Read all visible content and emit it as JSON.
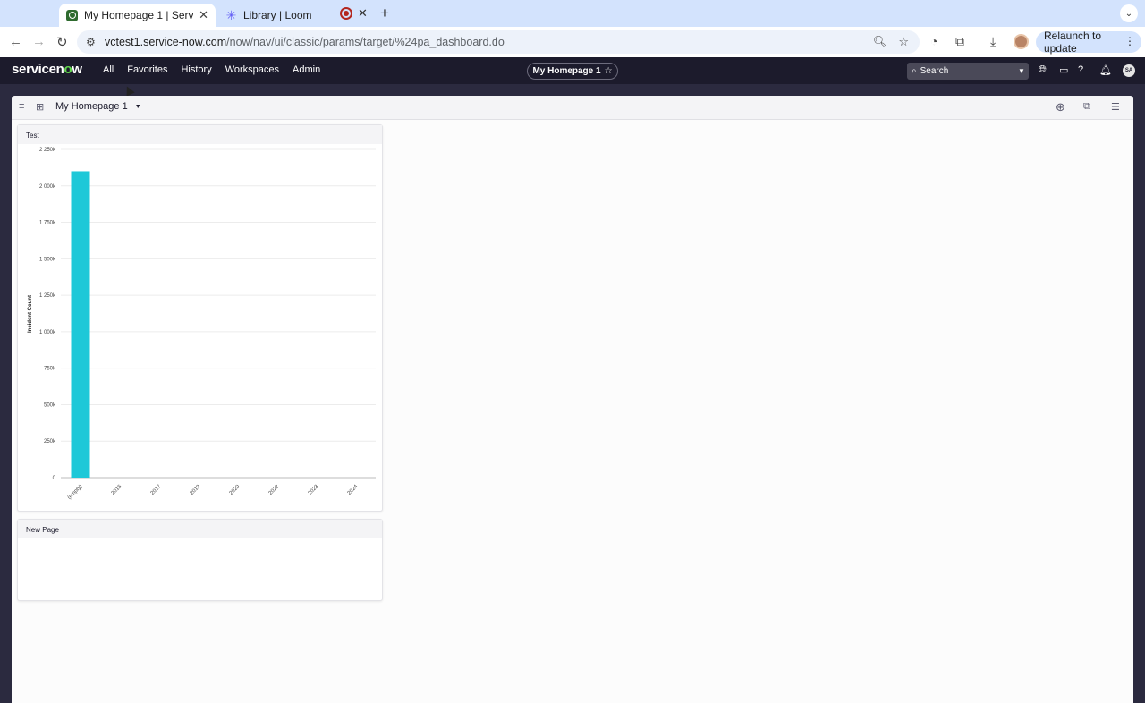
{
  "browser": {
    "tabs": [
      {
        "title": "My Homepage 1 | ServiceNow",
        "icon": "servicenow-favicon-icon",
        "active": true
      },
      {
        "title": "Library | Loom",
        "icon": "loom-favicon-icon",
        "active": false
      }
    ],
    "url_host": "vctest1.service-now.com",
    "url_path": "/now/nav/ui/classic/params/target/%24pa_dashboard.do",
    "relaunch_label": "Relaunch to update"
  },
  "servicenow": {
    "logo_text_before": "servicen",
    "logo_text_o": "o",
    "logo_text_after": "w",
    "nav": [
      "All",
      "Favorites",
      "History",
      "Workspaces",
      "Admin"
    ],
    "context_title": "My Homepage 1",
    "search_placeholder": "Search",
    "user_initials": "SA",
    "colors": {
      "header_bg": "#1c1b2c",
      "logo_accent": "#62d84e"
    }
  },
  "dashboard": {
    "title": "My Homepage 1",
    "widgets": [
      {
        "title": "Test"
      },
      {
        "title": "New Page"
      }
    ]
  },
  "chart_data": {
    "type": "bar",
    "title": "Test",
    "ylabel": "Incident Count",
    "xlabel": "",
    "categories": [
      "(empty)",
      "2016",
      "2017",
      "2019",
      "2020",
      "2022",
      "2023",
      "2024"
    ],
    "values": [
      2100000,
      0,
      0,
      0,
      0,
      0,
      0,
      0
    ],
    "ylim": [
      0,
      2250000
    ],
    "yticks": [
      {
        "value": 0,
        "label": "0"
      },
      {
        "value": 250000,
        "label": "250k"
      },
      {
        "value": 500000,
        "label": "500k"
      },
      {
        "value": 750000,
        "label": "750k"
      },
      {
        "value": 1000000,
        "label": "1 000k"
      },
      {
        "value": 1250000,
        "label": "1 250k"
      },
      {
        "value": 1500000,
        "label": "1 500k"
      },
      {
        "value": 1750000,
        "label": "1 750k"
      },
      {
        "value": 2000000,
        "label": "2 000k"
      },
      {
        "value": 2250000,
        "label": "2 250k"
      }
    ],
    "bar_color": "#1ec8d8",
    "grid": true,
    "legend": "none"
  }
}
